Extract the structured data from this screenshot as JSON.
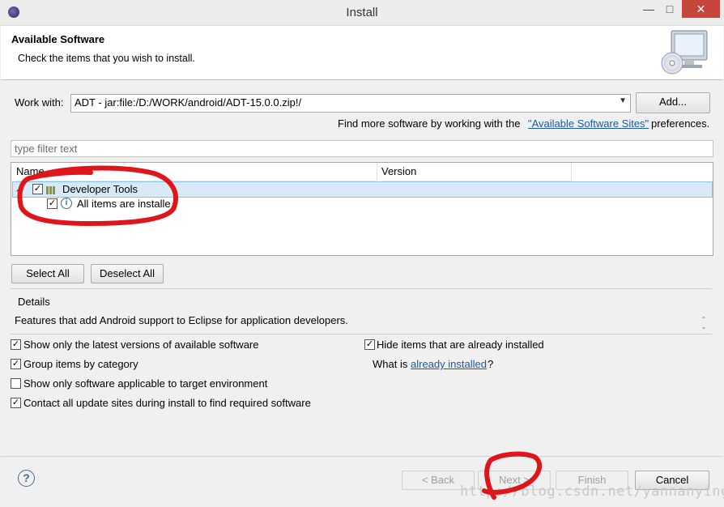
{
  "window": {
    "title": "Install"
  },
  "header": {
    "title": "Available Software",
    "description": "Check the items that you wish to install."
  },
  "work_with": {
    "label": "Work with:",
    "value": "ADT - jar:file:/D:/WORK/android/ADT-15.0.0.zip!/",
    "add_button": "Add..."
  },
  "find_more": {
    "prefix": "Find more software by working with the",
    "link": "\"Available Software Sites\"",
    "suffix": "preferences."
  },
  "filter": {
    "placeholder": "type filter text"
  },
  "tree": {
    "columns": [
      "Name",
      "Version"
    ],
    "rows": [
      {
        "label": "Developer Tools",
        "checked": true,
        "expanded": true
      },
      {
        "label": "All items are installe",
        "checked": true
      }
    ]
  },
  "buttons": {
    "select_all": "Select All",
    "deselect_all": "Deselect All"
  },
  "details": {
    "label": "Details",
    "text": "Features that add Android support to Eclipse for application developers."
  },
  "options": [
    {
      "label": "Show only the latest versions of available software",
      "checked": true
    },
    {
      "label": "Group items by category",
      "checked": true
    },
    {
      "label": "Show only software applicable to target environment",
      "checked": false
    },
    {
      "label": "Contact all update sites during install to find required software",
      "checked": true
    }
  ],
  "options_right": {
    "hide_installed": {
      "label": "Hide items that are already installed",
      "checked": true
    },
    "what_is_prefix": "What is",
    "what_is_link": "already installed",
    "what_is_suffix": "?"
  },
  "footer": {
    "back": "< Back",
    "next": "Next >",
    "finish": "Finish",
    "cancel": "Cancel"
  },
  "watermark": "http://blog.csdn.net/yannanying",
  "colors": {
    "selection": "#d8eaf8",
    "link": "#1a5aa6",
    "annotation": "#e0151b",
    "close": "#c7463c"
  }
}
